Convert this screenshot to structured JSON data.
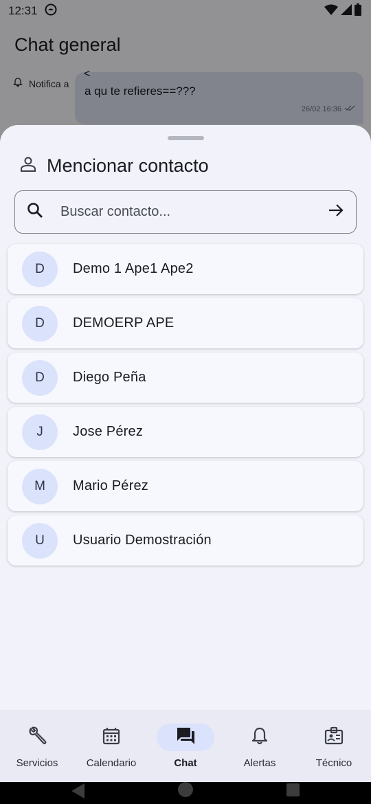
{
  "status_bar": {
    "time": "12:31"
  },
  "background": {
    "title": "Chat general",
    "notify_label": "Notifica a",
    "message": {
      "reply_marker": "<",
      "text": "a qu te refieres==???",
      "timestamp": "26/02 16:36"
    }
  },
  "sheet": {
    "title": "Mencionar contacto",
    "search": {
      "placeholder": "Buscar contacto...",
      "value": ""
    },
    "contacts": [
      {
        "initial": "D",
        "name": "Demo 1 Ape1 Ape2"
      },
      {
        "initial": "D",
        "name": "DEMOERP APE"
      },
      {
        "initial": "D",
        "name": "Diego Peña"
      },
      {
        "initial": "J",
        "name": "Jose Pérez"
      },
      {
        "initial": "M",
        "name": "Mario Pérez"
      },
      {
        "initial": "U",
        "name": "Usuario Demostración"
      }
    ]
  },
  "bottom_nav": {
    "active": "Chat",
    "items": [
      {
        "label": "Servicios",
        "icon": "wrench-icon"
      },
      {
        "label": "Calendario",
        "icon": "calendar-icon"
      },
      {
        "label": "Chat",
        "icon": "chat-icon"
      },
      {
        "label": "Alertas",
        "icon": "bell-icon"
      },
      {
        "label": "Técnico",
        "icon": "badge-icon"
      }
    ]
  },
  "colors": {
    "accent_container": "#dbe2fb",
    "sheet_bg": "#f2f3fa",
    "nav_bg": "#e9eaf4"
  }
}
